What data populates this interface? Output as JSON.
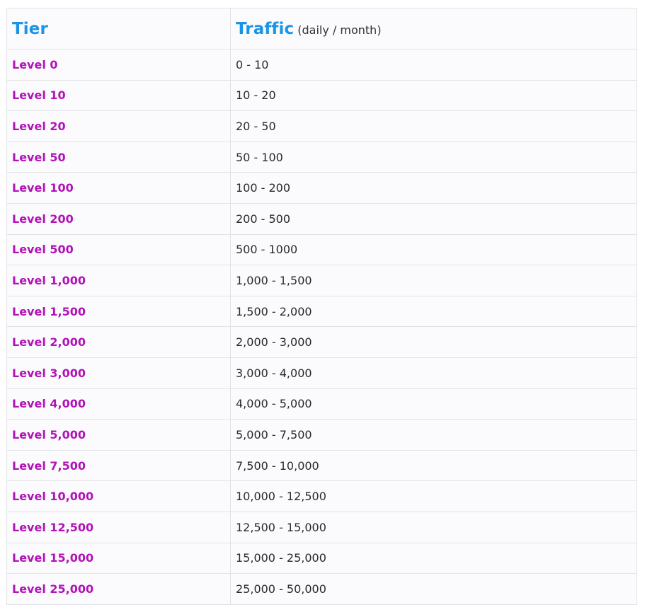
{
  "table": {
    "header": {
      "tier_label": "Tier",
      "traffic_label": "Traffic",
      "traffic_unit": "(daily / month)"
    },
    "rows": [
      {
        "tier": "Level 0",
        "traffic": "0 - 10"
      },
      {
        "tier": "Level 10",
        "traffic": "10 - 20"
      },
      {
        "tier": "Level 20",
        "traffic": "20 - 50"
      },
      {
        "tier": "Level 50",
        "traffic": "50 - 100"
      },
      {
        "tier": "Level 100",
        "traffic": "100 - 200"
      },
      {
        "tier": "Level 200",
        "traffic": "200 - 500"
      },
      {
        "tier": "Level 500",
        "traffic": "500 - 1000"
      },
      {
        "tier": "Level 1,000",
        "traffic": "1,000 - 1,500"
      },
      {
        "tier": "Level 1,500",
        "traffic": "1,500 - 2,000"
      },
      {
        "tier": "Level 2,000",
        "traffic": "2,000 - 3,000"
      },
      {
        "tier": "Level 3,000",
        "traffic": "3,000 - 4,000"
      },
      {
        "tier": "Level 4,000",
        "traffic": "4,000 - 5,000"
      },
      {
        "tier": "Level 5,000",
        "traffic": "5,000 - 7,500"
      },
      {
        "tier": "Level 7,500",
        "traffic": "7,500 - 10,000"
      },
      {
        "tier": "Level 10,000",
        "traffic": "10,000 - 12,500"
      },
      {
        "tier": "Level 12,500",
        "traffic": "12,500 - 15,000"
      },
      {
        "tier": "Level 15,000",
        "traffic": "15,000 - 25,000"
      },
      {
        "tier": "Level 25,000",
        "traffic": "25,000 - 50,000"
      }
    ]
  },
  "colors": {
    "header_text": "#1a94e6",
    "tier_text": "#b212b8",
    "body_text": "#2a2a2a",
    "border": "#e3e3e6"
  }
}
